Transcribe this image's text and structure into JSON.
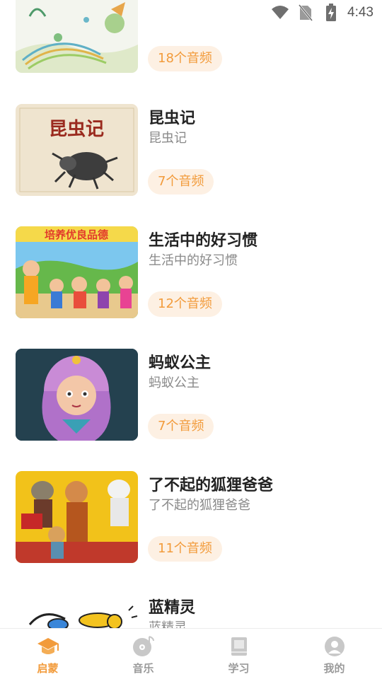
{
  "status_bar": {
    "time": "4:43"
  },
  "items": [
    {
      "title": "",
      "subtitle": "",
      "badge": "18个音频"
    },
    {
      "title": "昆虫记",
      "subtitle": "昆虫记",
      "badge": "7个音频",
      "thumb_text": "昆虫记"
    },
    {
      "title": "生活中的好习惯",
      "subtitle": "生活中的好习惯",
      "badge": "12个音频",
      "thumb_text": "培养优良品德"
    },
    {
      "title": "蚂蚁公主",
      "subtitle": "蚂蚁公主",
      "badge": "7个音频"
    },
    {
      "title": "了不起的狐狸爸爸",
      "subtitle": "了不起的狐狸爸爸",
      "badge": "11个音频"
    },
    {
      "title": "蓝精灵",
      "subtitle": "蓝精灵",
      "badge": ""
    }
  ],
  "nav": [
    {
      "label": "启蒙",
      "icon": "graduation-cap-icon",
      "active": true
    },
    {
      "label": "音乐",
      "icon": "music-disc-icon",
      "active": false
    },
    {
      "label": "学习",
      "icon": "book-icon",
      "active": false
    },
    {
      "label": "我的",
      "icon": "user-icon",
      "active": false
    }
  ],
  "colors": {
    "accent": "#f29b3b",
    "badge_bg": "#fdf0e3",
    "inactive": "#9a9a9a"
  }
}
